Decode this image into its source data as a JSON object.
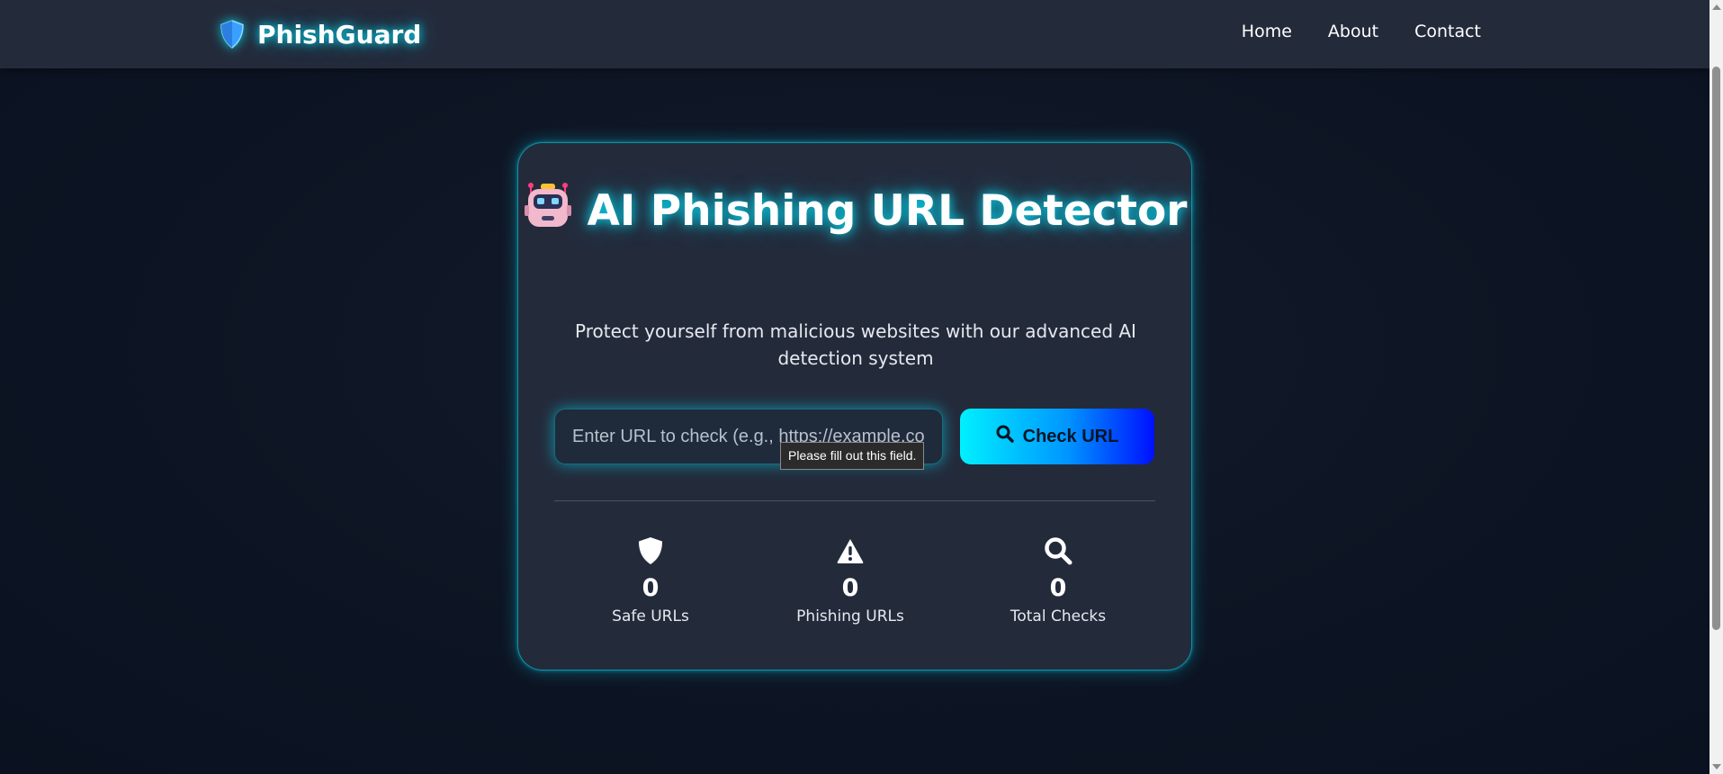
{
  "navbar": {
    "brand": "PhishGuard",
    "brand_icon": "shield-icon",
    "links": [
      {
        "label": "Home"
      },
      {
        "label": "About"
      },
      {
        "label": "Contact"
      }
    ]
  },
  "main": {
    "title": "AI Phishing URL Detector",
    "title_icon": "robot-icon",
    "subtitle": "Protect yourself from malicious websites with our advanced AI detection system",
    "input": {
      "placeholder": "Enter URL to check (e.g., https://example.com)",
      "value": "",
      "validation_tooltip": "Please fill out this field."
    },
    "check_button": {
      "label": "Check URL",
      "icon": "search-icon"
    },
    "stats": [
      {
        "icon": "shield-icon",
        "value": "0",
        "label": "Safe URLs"
      },
      {
        "icon": "warning-icon",
        "value": "0",
        "label": "Phishing URLs"
      },
      {
        "icon": "search-icon",
        "value": "0",
        "label": "Total Checks"
      }
    ]
  },
  "colors": {
    "background": "#0d1524",
    "navbar": "#232b3b",
    "card": "#232b3b",
    "accent_glow": "#00e5ff",
    "button_gradient_start": "#00f0ff",
    "button_gradient_end": "#0010ff"
  }
}
